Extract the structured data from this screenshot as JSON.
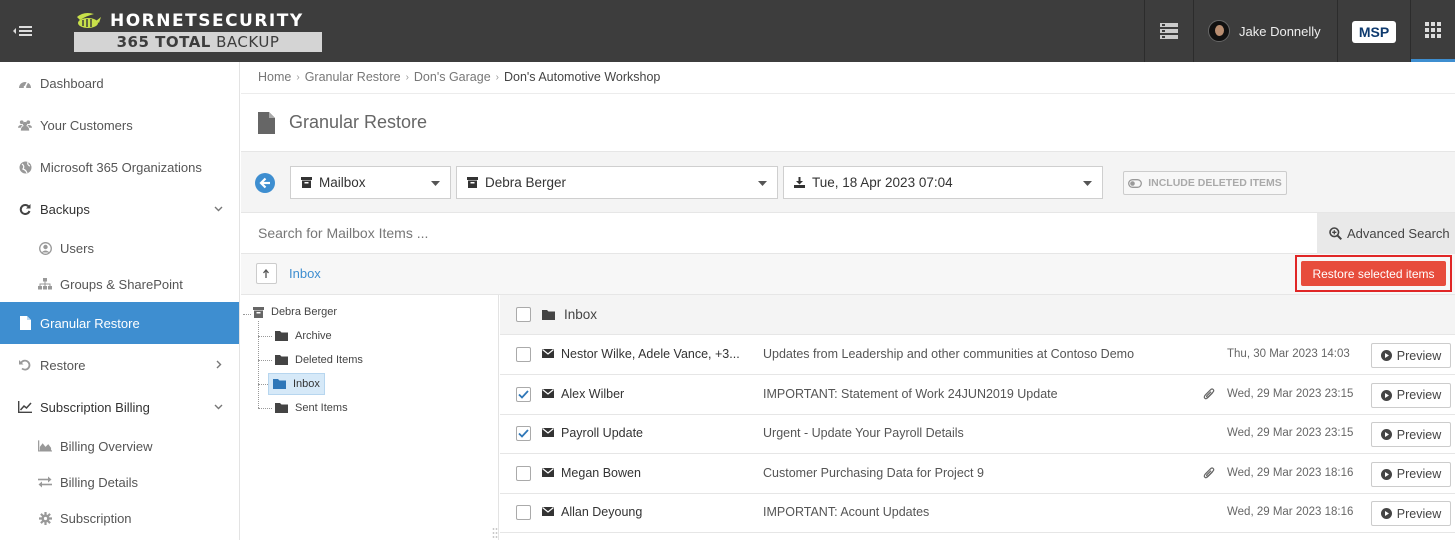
{
  "topbar": {
    "brand": "HORNETSECURITY",
    "product_bold": "365 TOTAL",
    "product_rest": " BACKUP",
    "user_name": "Jake Donnelly",
    "msp_badge": "MSP"
  },
  "sidebar": {
    "items": [
      {
        "label": "Dashboard",
        "icon": "dashboard-icon"
      },
      {
        "label": "Your Customers",
        "icon": "users-icon"
      },
      {
        "label": "Microsoft 365 Organizations",
        "icon": "globe-icon"
      },
      {
        "label": "Backups",
        "icon": "refresh-icon"
      },
      {
        "label": "Users",
        "icon": "user-circle-icon"
      },
      {
        "label": "Groups & SharePoint",
        "icon": "sitemap-icon"
      },
      {
        "label": "Granular Restore",
        "icon": "file-icon"
      },
      {
        "label": "Restore",
        "icon": "undo-icon"
      },
      {
        "label": "Subscription Billing",
        "icon": "line-chart-icon"
      },
      {
        "label": "Billing Overview",
        "icon": "area-chart-icon"
      },
      {
        "label": "Billing Details",
        "icon": "exchange-icon"
      },
      {
        "label": "Subscription",
        "icon": "gear-icon"
      }
    ]
  },
  "breadcrumb": [
    "Home",
    "Granular Restore",
    "Don's Garage",
    "Don's Automotive Workshop"
  ],
  "page": {
    "title": "Granular Restore"
  },
  "filters": {
    "type": "Mailbox",
    "user": "Debra Berger",
    "snapshot": "Tue, 18 Apr 2023 07:04",
    "include_deleted": "INCLUDE DELETED ITEMS"
  },
  "search": {
    "placeholder": "Search for Mailbox Items ...",
    "advanced": "Advanced Search"
  },
  "path": {
    "current": "Inbox",
    "restore_button": "Restore selected items"
  },
  "tree": {
    "root": "Debra Berger",
    "folders": [
      "Archive",
      "Deleted Items",
      "Inbox",
      "Sent Items"
    ],
    "selected": "Inbox"
  },
  "list": {
    "folder": "Inbox",
    "preview_label": "Preview",
    "rows": [
      {
        "sender": "Nestor Wilke, Adele Vance, +3...",
        "subject": "Updates from Leadership and other communities at Contoso Demo",
        "date": "Thu, 30 Mar 2023 14:03",
        "checked": false,
        "attachment": false
      },
      {
        "sender": "Alex Wilber",
        "subject": "IMPORTANT: Statement of Work 24JUN2019 Update",
        "date": "Wed, 29 Mar 2023 23:15",
        "checked": true,
        "attachment": true
      },
      {
        "sender": "Payroll Update",
        "subject": "Urgent - Update Your Payroll Details",
        "date": "Wed, 29 Mar 2023 23:15",
        "checked": true,
        "attachment": false
      },
      {
        "sender": "Megan Bowen",
        "subject": "Customer Purchasing Data for Project 9",
        "date": "Wed, 29 Mar 2023 18:16",
        "checked": false,
        "attachment": true
      },
      {
        "sender": "Allan Deyoung",
        "subject": "IMPORTANT: Acount Updates",
        "date": "Wed, 29 Mar 2023 18:16",
        "checked": false,
        "attachment": false
      }
    ]
  },
  "colors": {
    "accent": "#3e8ed0",
    "danger": "#e74c3c",
    "topbar": "#3d3d3d"
  }
}
